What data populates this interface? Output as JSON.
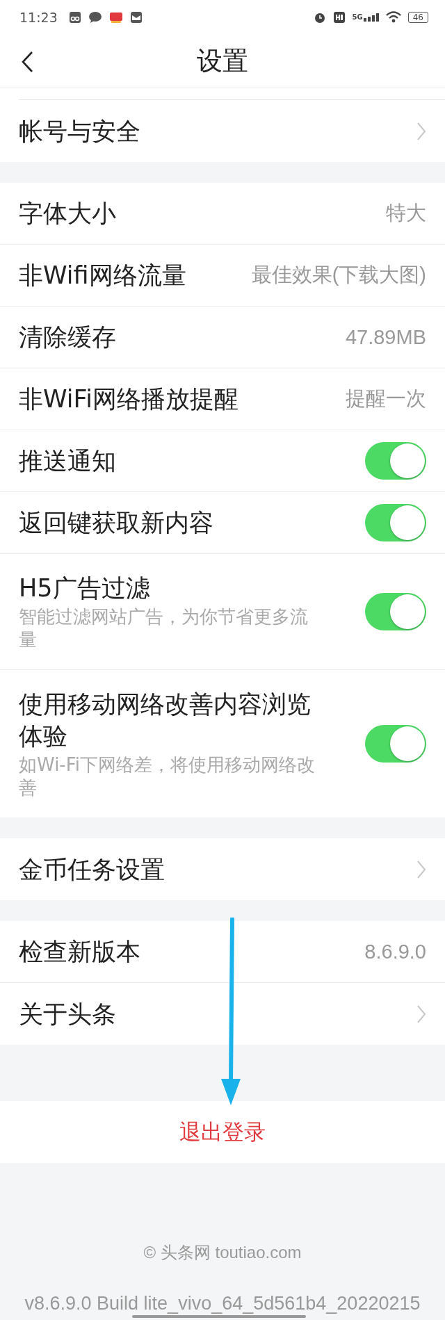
{
  "status_bar": {
    "time": "11:23",
    "network": "5G",
    "battery": "46"
  },
  "nav": {
    "title": "设置"
  },
  "groups": [
    {
      "rows": [
        {
          "kind": "chevron",
          "label": "帐号与安全"
        }
      ]
    },
    {
      "rows": [
        {
          "kind": "value",
          "label": "字体大小",
          "value": "特大"
        },
        {
          "kind": "value",
          "label": "非Wifi网络流量",
          "value": "最佳效果(下载大图)"
        },
        {
          "kind": "value",
          "label": "清除缓存",
          "value": "47.89MB"
        },
        {
          "kind": "value",
          "label": "非WiFi网络播放提醒",
          "value": "提醒一次"
        },
        {
          "kind": "toggle",
          "label": "推送通知",
          "on": true
        },
        {
          "kind": "toggle",
          "label": "返回键获取新内容",
          "on": true
        },
        {
          "kind": "toggle",
          "label": "H5广告过滤",
          "subtitle": "智能过滤网站广告，为你节省更多流量",
          "on": true
        },
        {
          "kind": "toggle",
          "label": "使用移动网络改善内容浏览体验",
          "subtitle": "如Wi-Fi下网络差，将使用移动网络改善",
          "on": true
        }
      ]
    },
    {
      "rows": [
        {
          "kind": "chevron",
          "label": "金币任务设置"
        }
      ]
    },
    {
      "rows": [
        {
          "kind": "value",
          "label": "检查新版本",
          "value": "8.6.9.0"
        },
        {
          "kind": "chevron",
          "label": "关于头条"
        }
      ]
    }
  ],
  "logout": {
    "label": "退出登录"
  },
  "footer": {
    "copyright": "© 头条网 toutiao.com",
    "build": "v8.6.9.0 Build lite_vivo_64_5d561b4_20220215"
  },
  "annotation": {
    "kind": "arrow",
    "color": "#1ab2ea"
  }
}
